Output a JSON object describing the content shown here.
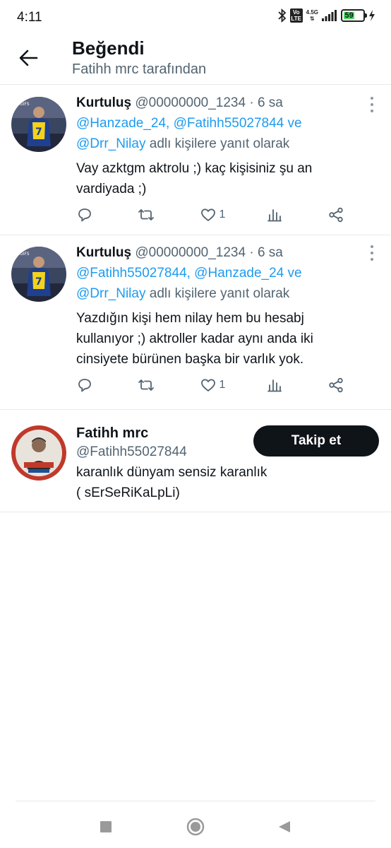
{
  "status_bar": {
    "time": "4:11",
    "volte_top": "Vo",
    "volte_bottom": "LTE",
    "network_type": "4.5G",
    "battery_level": "59",
    "battery_fraction": 0.59
  },
  "header": {
    "title": "Beğendi",
    "subtitle": "Fatihh mrc tarafından"
  },
  "tweets": [
    {
      "author": "Kurtuluş",
      "handle": "@00000000_1234",
      "separator": "·",
      "time": "6 sa",
      "mentions": "@Hanzade_24, @Fatihh55027844 ve",
      "mention_last": "@Drr_Nilay",
      "reply_suffix": "adlı kişilere yanıt olarak",
      "text_line1": "Vay azktgm aktrolu ;) kaç kişisiniz şu an",
      "text_line2": "vardiyada ;)",
      "text_line3": "",
      "like_count": "1"
    },
    {
      "author": "Kurtuluş",
      "handle": "@00000000_1234",
      "separator": "·",
      "time": "6 sa",
      "mentions": "@Fatihh55027844, @Hanzade_24 ve",
      "mention_last": "@Drr_Nilay",
      "reply_suffix": "adlı kişilere yanıt olarak",
      "text_line1": "Yazdığın kişi hem nilay hem bu hesabj",
      "text_line2": "kullanıyor ;) aktroller kadar aynı anda iki",
      "text_line3": "cinsiyete bürünen başka bir varlık yok.",
      "like_count": "1"
    }
  ],
  "user_card": {
    "name": "Fatihh mrc",
    "handle": "@Fatihh55027844",
    "bio_line1": "karanlık dünyam sensiz karanlık",
    "bio_line2": "( sErSeRiKaLpLi)",
    "follow_label": "Takip et"
  },
  "icons": {
    "reply": "reply-icon",
    "retweet": "retweet-icon",
    "like": "heart-icon",
    "views": "analytics-icon",
    "share": "share-icon"
  },
  "colors": {
    "accent": "#1d9bf0",
    "text": "#0f1419",
    "secondary": "#536471",
    "button": "#0f1419",
    "battery": "#4cd964"
  }
}
